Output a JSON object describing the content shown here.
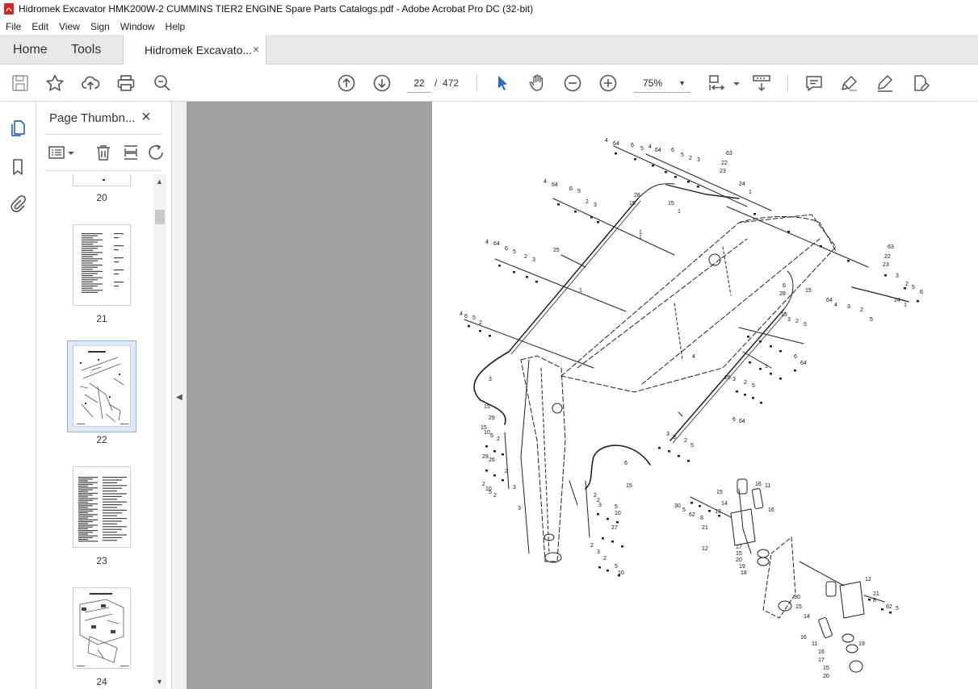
{
  "window": {
    "title": "Hidromek Excavator HMK200W-2 CUMMINS TIER2 ENGINE Spare Parts Catalogs.pdf - Adobe Acrobat Pro DC (32-bit)"
  },
  "menu": [
    "File",
    "Edit",
    "View",
    "Sign",
    "Window",
    "Help"
  ],
  "tabs": {
    "home": "Home",
    "tools": "Tools",
    "document": "Hidromek Excavato...",
    "close_glyph": "×"
  },
  "toolbar": {
    "current_page": "22",
    "page_separator": "/",
    "total_pages": "472",
    "zoom": "75%"
  },
  "thumbnails_panel": {
    "title": "Page Thumbn...",
    "close_glyph": "×",
    "pages": [
      {
        "label": "20"
      },
      {
        "label": "21"
      },
      {
        "label": "22",
        "selected": true
      },
      {
        "label": "23"
      },
      {
        "label": "24"
      }
    ]
  },
  "diagram": {
    "callouts": [
      "4",
      "64",
      "6",
      "5",
      "4",
      "64",
      "6",
      "5",
      "2",
      "3",
      "63",
      "22",
      "23",
      "24",
      "1",
      "28",
      "15",
      "15",
      "1",
      "4",
      "64",
      "6",
      "5",
      "2",
      "3",
      "25",
      "1",
      "1",
      "4",
      "64",
      "6",
      "5",
      "2",
      "3",
      "1",
      "63",
      "22",
      "23",
      "3",
      "2",
      "5",
      "6",
      "24",
      "1",
      "64",
      "4",
      "3",
      "2",
      "5",
      "6",
      "28",
      "15",
      "15",
      "3",
      "2",
      "5",
      "6",
      "64",
      "4",
      "1",
      "25",
      "3",
      "2",
      "5",
      "6",
      "64",
      "4",
      "6",
      "5",
      "2",
      "3",
      "15",
      "29",
      "15",
      "10",
      "5",
      "2",
      "3",
      "3",
      "2",
      "5",
      "6",
      "15",
      "29",
      "26",
      "2",
      "3",
      "2",
      "10",
      "5",
      "2",
      "3",
      "2",
      "2",
      "3",
      "5",
      "10",
      "27",
      "2",
      "3",
      "2",
      "5",
      "10",
      "30",
      "5",
      "62",
      "8",
      "21",
      "12",
      "15",
      "14",
      "13",
      "16",
      "11",
      "16",
      "17",
      "15",
      "20",
      "19",
      "18",
      "12",
      "21",
      "8",
      "62",
      "5",
      "30",
      "15",
      "14",
      "16",
      "11",
      "16",
      "17",
      "15",
      "20",
      "19",
      "18",
      "13"
    ]
  },
  "colors": {
    "accent": "#2b6cc4",
    "doc_background": "#a0a0a0",
    "selected_thumb": "#6aa0d8"
  },
  "icons": {
    "save": "save-icon",
    "bookmark": "star-icon",
    "upload": "cloud-upload-icon",
    "print": "printer-icon",
    "search": "zoom-search-icon",
    "prev": "arrow-up-circle-icon",
    "next": "arrow-down-circle-icon",
    "select": "cursor-arrow-icon",
    "hand": "hand-icon",
    "zoom_out": "minus-circle-icon",
    "zoom_in": "plus-circle-icon",
    "fit": "fit-page-icon",
    "scroll": "scroll-mode-icon",
    "comment": "comment-icon",
    "highlight": "highlighter-icon",
    "sign": "pen-sign-icon",
    "edit_pdf": "edit-pdf-icon"
  }
}
